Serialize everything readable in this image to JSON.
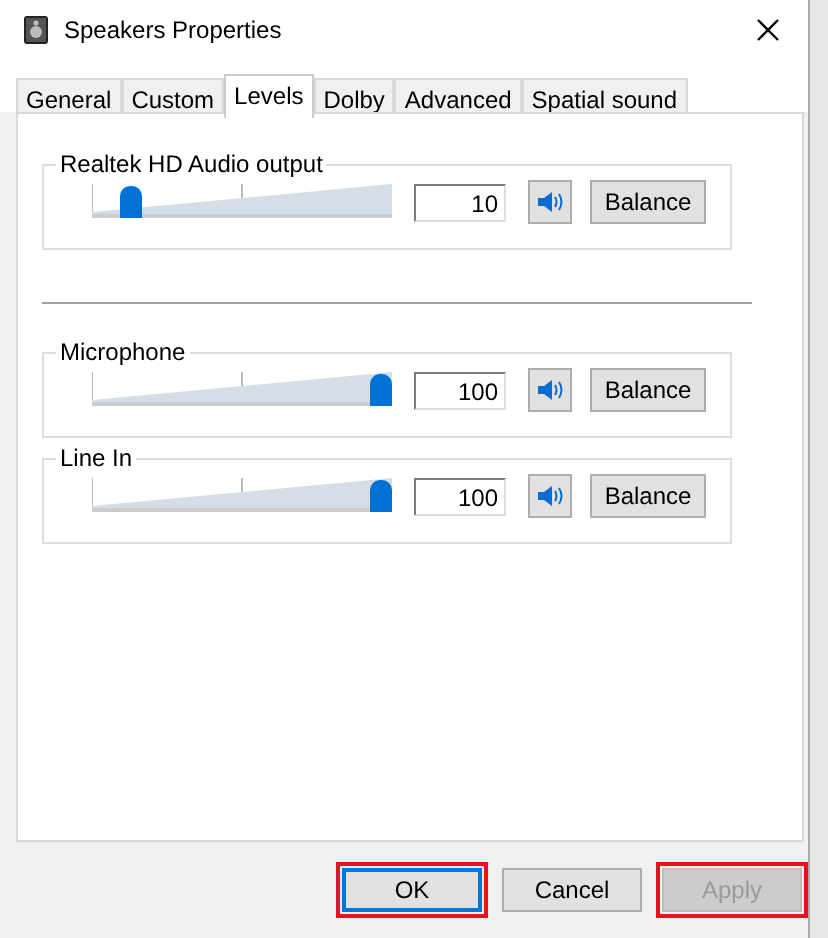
{
  "window": {
    "title": "Speakers Properties"
  },
  "tabs": [
    {
      "label": "General",
      "selected": false
    },
    {
      "label": "Custom",
      "selected": false
    },
    {
      "label": "Levels",
      "selected": true
    },
    {
      "label": "Dolby",
      "selected": false
    },
    {
      "label": "Advanced",
      "selected": false
    },
    {
      "label": "Spatial sound",
      "selected": false
    }
  ],
  "output": {
    "name": "Realtek HD Audio output",
    "level": 0.1,
    "value": "10",
    "muted": false,
    "balance": "Balance"
  },
  "inputs": [
    {
      "name": "Microphone",
      "level": 1,
      "value": "100",
      "muted": false,
      "balance": "Balance"
    },
    {
      "name": "Line In",
      "level": 1,
      "value": "100",
      "muted": false,
      "balance": "Balance"
    }
  ],
  "buttons": [
    {
      "label": "OK",
      "default": true,
      "disabled": false,
      "highlighted": true
    },
    {
      "label": "Cancel",
      "default": false,
      "disabled": false,
      "highlighted": false
    },
    {
      "label": "Apply",
      "default": false,
      "disabled": true,
      "highlighted": true
    }
  ]
}
